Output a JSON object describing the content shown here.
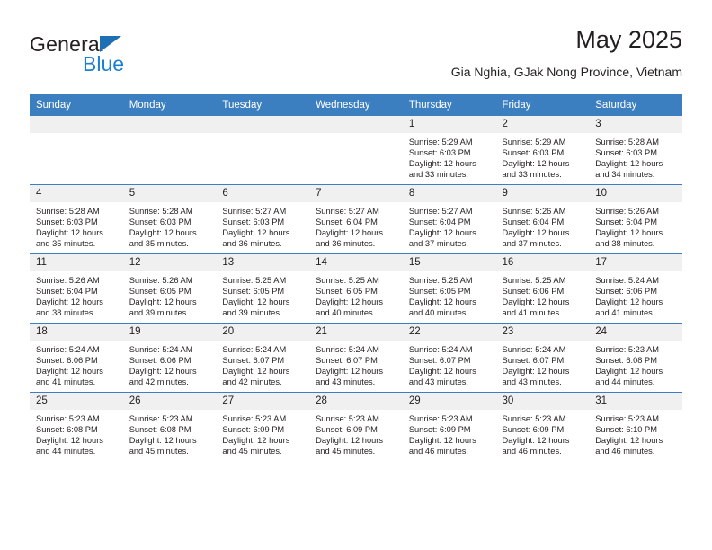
{
  "branding": {
    "name_part1": "General",
    "name_part2": "Blue",
    "triangle_color": "#1f6fb5",
    "blue_color": "#1b7fd4"
  },
  "header": {
    "title": "May 2025",
    "subtitle": "Gia Nghia, GJak Nong Province, Vietnam"
  },
  "theme": {
    "header_blue": "#3c7fc1",
    "daynum_band": "#f0f0f0",
    "text": "#231f20"
  },
  "weekday_headers": [
    "Sunday",
    "Monday",
    "Tuesday",
    "Wednesday",
    "Thursday",
    "Friday",
    "Saturday"
  ],
  "labels": {
    "sunrise_prefix": "Sunrise:",
    "sunset_prefix": "Sunset:",
    "daylight_prefix": "Daylight:"
  },
  "weeks": [
    [
      {
        "day": "",
        "sunrise": "",
        "sunset": "",
        "daylight_line1": "",
        "daylight_line2": "",
        "empty": true
      },
      {
        "day": "",
        "sunrise": "",
        "sunset": "",
        "daylight_line1": "",
        "daylight_line2": "",
        "empty": true
      },
      {
        "day": "",
        "sunrise": "",
        "sunset": "",
        "daylight_line1": "",
        "daylight_line2": "",
        "empty": true
      },
      {
        "day": "",
        "sunrise": "",
        "sunset": "",
        "daylight_line1": "",
        "daylight_line2": "",
        "empty": true
      },
      {
        "day": "1",
        "sunrise": "Sunrise: 5:29 AM",
        "sunset": "Sunset: 6:03 PM",
        "daylight_line1": "Daylight: 12 hours",
        "daylight_line2": "and 33 minutes.",
        "empty": false
      },
      {
        "day": "2",
        "sunrise": "Sunrise: 5:29 AM",
        "sunset": "Sunset: 6:03 PM",
        "daylight_line1": "Daylight: 12 hours",
        "daylight_line2": "and 33 minutes.",
        "empty": false
      },
      {
        "day": "3",
        "sunrise": "Sunrise: 5:28 AM",
        "sunset": "Sunset: 6:03 PM",
        "daylight_line1": "Daylight: 12 hours",
        "daylight_line2": "and 34 minutes.",
        "empty": false
      }
    ],
    [
      {
        "day": "4",
        "sunrise": "Sunrise: 5:28 AM",
        "sunset": "Sunset: 6:03 PM",
        "daylight_line1": "Daylight: 12 hours",
        "daylight_line2": "and 35 minutes.",
        "empty": false
      },
      {
        "day": "5",
        "sunrise": "Sunrise: 5:28 AM",
        "sunset": "Sunset: 6:03 PM",
        "daylight_line1": "Daylight: 12 hours",
        "daylight_line2": "and 35 minutes.",
        "empty": false
      },
      {
        "day": "6",
        "sunrise": "Sunrise: 5:27 AM",
        "sunset": "Sunset: 6:03 PM",
        "daylight_line1": "Daylight: 12 hours",
        "daylight_line2": "and 36 minutes.",
        "empty": false
      },
      {
        "day": "7",
        "sunrise": "Sunrise: 5:27 AM",
        "sunset": "Sunset: 6:04 PM",
        "daylight_line1": "Daylight: 12 hours",
        "daylight_line2": "and 36 minutes.",
        "empty": false
      },
      {
        "day": "8",
        "sunrise": "Sunrise: 5:27 AM",
        "sunset": "Sunset: 6:04 PM",
        "daylight_line1": "Daylight: 12 hours",
        "daylight_line2": "and 37 minutes.",
        "empty": false
      },
      {
        "day": "9",
        "sunrise": "Sunrise: 5:26 AM",
        "sunset": "Sunset: 6:04 PM",
        "daylight_line1": "Daylight: 12 hours",
        "daylight_line2": "and 37 minutes.",
        "empty": false
      },
      {
        "day": "10",
        "sunrise": "Sunrise: 5:26 AM",
        "sunset": "Sunset: 6:04 PM",
        "daylight_line1": "Daylight: 12 hours",
        "daylight_line2": "and 38 minutes.",
        "empty": false
      }
    ],
    [
      {
        "day": "11",
        "sunrise": "Sunrise: 5:26 AM",
        "sunset": "Sunset: 6:04 PM",
        "daylight_line1": "Daylight: 12 hours",
        "daylight_line2": "and 38 minutes.",
        "empty": false
      },
      {
        "day": "12",
        "sunrise": "Sunrise: 5:26 AM",
        "sunset": "Sunset: 6:05 PM",
        "daylight_line1": "Daylight: 12 hours",
        "daylight_line2": "and 39 minutes.",
        "empty": false
      },
      {
        "day": "13",
        "sunrise": "Sunrise: 5:25 AM",
        "sunset": "Sunset: 6:05 PM",
        "daylight_line1": "Daylight: 12 hours",
        "daylight_line2": "and 39 minutes.",
        "empty": false
      },
      {
        "day": "14",
        "sunrise": "Sunrise: 5:25 AM",
        "sunset": "Sunset: 6:05 PM",
        "daylight_line1": "Daylight: 12 hours",
        "daylight_line2": "and 40 minutes.",
        "empty": false
      },
      {
        "day": "15",
        "sunrise": "Sunrise: 5:25 AM",
        "sunset": "Sunset: 6:05 PM",
        "daylight_line1": "Daylight: 12 hours",
        "daylight_line2": "and 40 minutes.",
        "empty": false
      },
      {
        "day": "16",
        "sunrise": "Sunrise: 5:25 AM",
        "sunset": "Sunset: 6:06 PM",
        "daylight_line1": "Daylight: 12 hours",
        "daylight_line2": "and 41 minutes.",
        "empty": false
      },
      {
        "day": "17",
        "sunrise": "Sunrise: 5:24 AM",
        "sunset": "Sunset: 6:06 PM",
        "daylight_line1": "Daylight: 12 hours",
        "daylight_line2": "and 41 minutes.",
        "empty": false
      }
    ],
    [
      {
        "day": "18",
        "sunrise": "Sunrise: 5:24 AM",
        "sunset": "Sunset: 6:06 PM",
        "daylight_line1": "Daylight: 12 hours",
        "daylight_line2": "and 41 minutes.",
        "empty": false
      },
      {
        "day": "19",
        "sunrise": "Sunrise: 5:24 AM",
        "sunset": "Sunset: 6:06 PM",
        "daylight_line1": "Daylight: 12 hours",
        "daylight_line2": "and 42 minutes.",
        "empty": false
      },
      {
        "day": "20",
        "sunrise": "Sunrise: 5:24 AM",
        "sunset": "Sunset: 6:07 PM",
        "daylight_line1": "Daylight: 12 hours",
        "daylight_line2": "and 42 minutes.",
        "empty": false
      },
      {
        "day": "21",
        "sunrise": "Sunrise: 5:24 AM",
        "sunset": "Sunset: 6:07 PM",
        "daylight_line1": "Daylight: 12 hours",
        "daylight_line2": "and 43 minutes.",
        "empty": false
      },
      {
        "day": "22",
        "sunrise": "Sunrise: 5:24 AM",
        "sunset": "Sunset: 6:07 PM",
        "daylight_line1": "Daylight: 12 hours",
        "daylight_line2": "and 43 minutes.",
        "empty": false
      },
      {
        "day": "23",
        "sunrise": "Sunrise: 5:24 AM",
        "sunset": "Sunset: 6:07 PM",
        "daylight_line1": "Daylight: 12 hours",
        "daylight_line2": "and 43 minutes.",
        "empty": false
      },
      {
        "day": "24",
        "sunrise": "Sunrise: 5:23 AM",
        "sunset": "Sunset: 6:08 PM",
        "daylight_line1": "Daylight: 12 hours",
        "daylight_line2": "and 44 minutes.",
        "empty": false
      }
    ],
    [
      {
        "day": "25",
        "sunrise": "Sunrise: 5:23 AM",
        "sunset": "Sunset: 6:08 PM",
        "daylight_line1": "Daylight: 12 hours",
        "daylight_line2": "and 44 minutes.",
        "empty": false
      },
      {
        "day": "26",
        "sunrise": "Sunrise: 5:23 AM",
        "sunset": "Sunset: 6:08 PM",
        "daylight_line1": "Daylight: 12 hours",
        "daylight_line2": "and 45 minutes.",
        "empty": false
      },
      {
        "day": "27",
        "sunrise": "Sunrise: 5:23 AM",
        "sunset": "Sunset: 6:09 PM",
        "daylight_line1": "Daylight: 12 hours",
        "daylight_line2": "and 45 minutes.",
        "empty": false
      },
      {
        "day": "28",
        "sunrise": "Sunrise: 5:23 AM",
        "sunset": "Sunset: 6:09 PM",
        "daylight_line1": "Daylight: 12 hours",
        "daylight_line2": "and 45 minutes.",
        "empty": false
      },
      {
        "day": "29",
        "sunrise": "Sunrise: 5:23 AM",
        "sunset": "Sunset: 6:09 PM",
        "daylight_line1": "Daylight: 12 hours",
        "daylight_line2": "and 46 minutes.",
        "empty": false
      },
      {
        "day": "30",
        "sunrise": "Sunrise: 5:23 AM",
        "sunset": "Sunset: 6:09 PM",
        "daylight_line1": "Daylight: 12 hours",
        "daylight_line2": "and 46 minutes.",
        "empty": false
      },
      {
        "day": "31",
        "sunrise": "Sunrise: 5:23 AM",
        "sunset": "Sunset: 6:10 PM",
        "daylight_line1": "Daylight: 12 hours",
        "daylight_line2": "and 46 minutes.",
        "empty": false
      }
    ]
  ]
}
